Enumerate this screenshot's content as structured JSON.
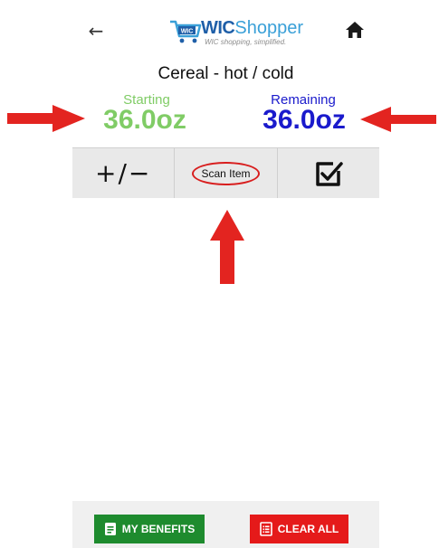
{
  "header": {
    "back_icon": "back-arrow-icon",
    "home_icon": "home-icon",
    "logo": {
      "badge": "WIC",
      "word_bold": "WIC",
      "word_light": "Shopper",
      "tagline": "WIC shopping, simplified."
    }
  },
  "category": {
    "title": "Cereal - hot / cold",
    "starting_label": "Starting",
    "starting_value": "36.0oz",
    "remaining_label": "Remaining",
    "remaining_value": "36.0oz"
  },
  "toolbar": {
    "adjust_label": "+/−",
    "scan_label": "Scan Item",
    "checkout_icon": "check-box-icon"
  },
  "footer": {
    "benefits_label": "MY BENEFITS",
    "clear_label": "CLEAR ALL"
  },
  "colors": {
    "starting": "#80cc66",
    "remaining": "#1a1acc",
    "benefits_button": "#1e8b2e",
    "clear_button": "#e51a1a",
    "annotation_arrow": "#e32420"
  }
}
